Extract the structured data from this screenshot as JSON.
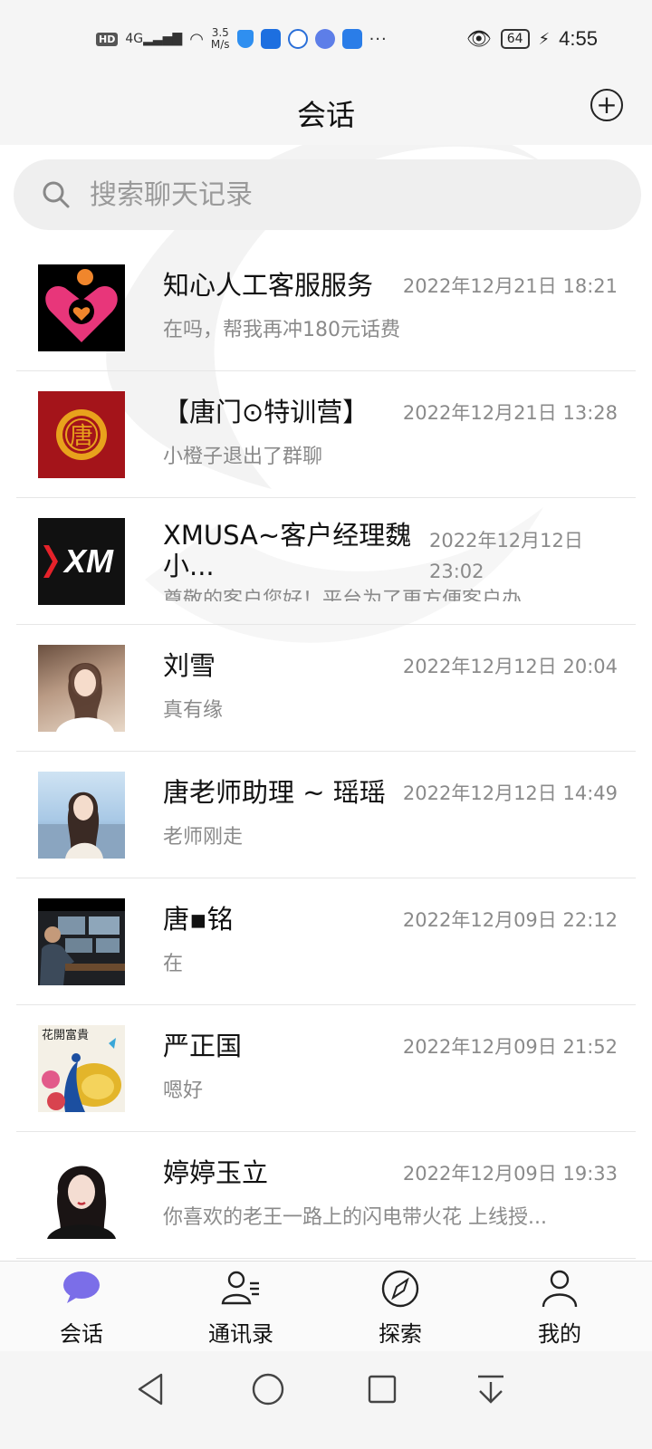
{
  "status_bar": {
    "hd": "HD",
    "network": "4G",
    "speed_value": "3.5",
    "speed_unit": "M/s",
    "dots": "···",
    "battery": "64",
    "time": "4:55"
  },
  "header": {
    "title": "会话"
  },
  "search": {
    "placeholder": "搜索聊天记录"
  },
  "chats": [
    {
      "name": "知心人工客服服务",
      "time": "2022年12月21日 18:21",
      "preview": "在吗，帮我再冲180元话费",
      "avatar": "heart-logo-avatar"
    },
    {
      "name": "【唐门⊙特训营】",
      "time": "2022年12月21日 13:28",
      "preview": "小橙子退出了群聊",
      "avatar": "tang-seal-avatar"
    },
    {
      "name": "XMUSA~客户经理魏小...",
      "time": "2022年12月12日 23:02",
      "preview": "尊敬的客户您好！平台为了更方便客户办",
      "avatar": "xm-logo-avatar"
    },
    {
      "name": "刘雪",
      "time": "2022年12月12日 20:04",
      "preview": "真有缘",
      "avatar": "woman-photo-avatar"
    },
    {
      "name": "唐老师助理 ~ 瑶瑶",
      "time": "2022年12月12日 14:49",
      "preview": "老师刚走",
      "avatar": "woman-beach-avatar"
    },
    {
      "name": "唐▪铭",
      "time": "2022年12月09日 22:12",
      "preview": "在",
      "avatar": "trading-desk-avatar"
    },
    {
      "name": "严正国",
      "time": "2022年12月09日 21:52",
      "preview": "嗯好",
      "avatar": "peacock-painting-avatar"
    },
    {
      "name": "婷婷玉立",
      "time": "2022年12月09日 19:33",
      "preview": "你喜欢的老王一路上的闪电带火花 上线授...",
      "avatar": "woman-portrait-avatar"
    }
  ],
  "avatar_text": {
    "painting_caption": "花開富貴",
    "xm_logo": "XM",
    "seal_char": "唐"
  },
  "nav": [
    {
      "label": "会话",
      "icon": "chat-bubble-icon"
    },
    {
      "label": "通讯录",
      "icon": "contacts-icon"
    },
    {
      "label": "探索",
      "icon": "compass-icon"
    },
    {
      "label": "我的",
      "icon": "person-icon"
    }
  ],
  "colors": {
    "accent": "#7b6ee8",
    "text_secondary": "#8a8a8a",
    "background": "#f5f5f5"
  }
}
